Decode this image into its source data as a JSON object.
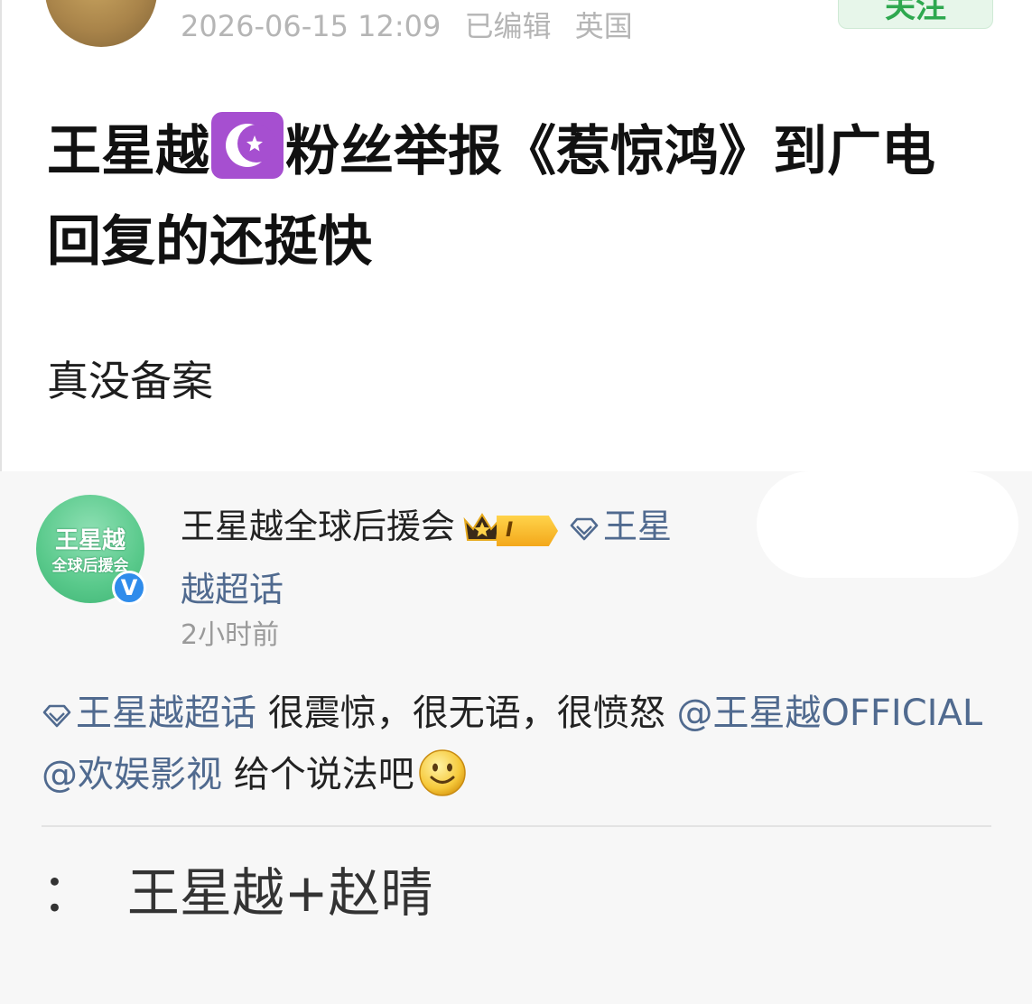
{
  "top_post": {
    "date": "2026-06-15 12:09",
    "edited": "已编辑",
    "location": "英国",
    "follow_label": "关注",
    "title_before_emoji": "王星越",
    "moon_emoji": "purple-crescent-star-icon",
    "title_after_emoji": "粉丝举报《惹惊鸿》到广电回复的还挺快",
    "body": "真没备案"
  },
  "fan_post": {
    "name": "王星越全球后援会",
    "avatar_line1": "王星越",
    "avatar_line2": "全球后援会",
    "verified": "V",
    "level": "I",
    "topic": "王星越超话",
    "time": "2小时前",
    "comment": {
      "topic": "王星越超话",
      "text1": " 很震惊，很无语，很愤怒",
      "mention1": "@王星越OFFICIAL",
      "mention2": "@欢娱影视",
      "text2": " 给个说法吧"
    },
    "caption": "：  王星越+赵晴"
  },
  "colors": {
    "link": "#506a8f",
    "follow_green": "#2ea84f",
    "moon_purple": "#a64fd0",
    "verified_blue": "#2f8ceb",
    "level_gold": "#f3a81b"
  }
}
